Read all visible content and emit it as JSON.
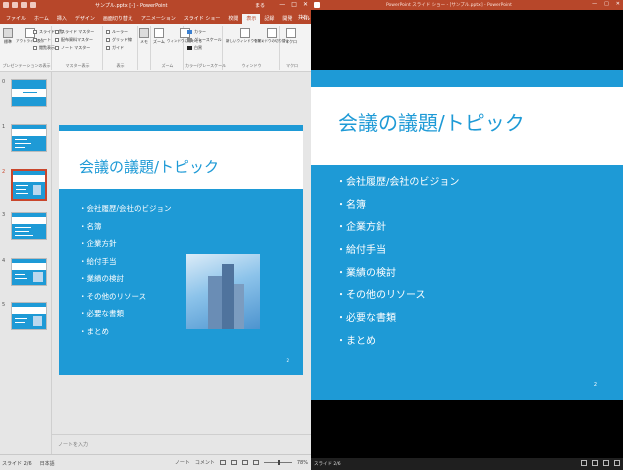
{
  "editor": {
    "title": "サンプル.pptx [-] - PowerPoint",
    "user": "まる",
    "window_controls": [
      "—",
      "□",
      "✕"
    ],
    "tabs": [
      "ファイル",
      "ホーム",
      "挿入",
      "デザイン",
      "画面切り替え",
      "アニメーション",
      "スライド ショー",
      "校閲",
      "表示",
      "記録",
      "開発",
      "ヘルプ",
      "操作アシスト"
    ],
    "active_tab": "表示",
    "share_label": "共有",
    "ribbon": {
      "groups": [
        "プレゼンテーションの表示",
        "マスター表示",
        "表示",
        "ズーム",
        "カラー/グレースケール",
        "ウィンドウ",
        "マクロ"
      ],
      "buttons": {
        "normal": "標準",
        "outline": "アウトライン表示",
        "slide_sorter": "スライド一覧",
        "notes_page": "ノート",
        "reading_view": "閲覧表示",
        "slide_master": "スライド マスター",
        "handout_master": "配布資料マスター",
        "notes_master": "ノート マスター",
        "ruler": "ルーラー",
        "gridlines": "グリッド線",
        "guides": "ガイド",
        "notes": "メモ",
        "zoom": "ズーム",
        "fit_window": "ウィンドウに合わせる",
        "color": "カラー",
        "grayscale": "グレースケール",
        "black_white": "白黒",
        "new_window": "新しいウィンドウを開く",
        "arrange": "ウィンドウの切り替え",
        "macros": "マクロ"
      }
    },
    "thumbnails": [
      {
        "num": "0",
        "label": "メインタイトル"
      },
      {
        "num": "1",
        "label": ""
      },
      {
        "num": "2",
        "label": ""
      },
      {
        "num": "3",
        "label": ""
      },
      {
        "num": "4",
        "label": ""
      },
      {
        "num": "5",
        "label": ""
      }
    ],
    "active_thumbnail": 2,
    "notes_placeholder": "ノートを入力",
    "status": {
      "slide": "スライド 2/6",
      "language": "日本語",
      "notes": "ノート",
      "comments": "コメント",
      "zoom": "78%"
    }
  },
  "slide": {
    "title": "会議の議題/トピック",
    "bullets": [
      "・会社履歴/会社のビジョン",
      "・名簿",
      "・企業方針",
      "・給付手当",
      "・業績の検討",
      "・その他のリソース",
      "・必要な書類",
      "・まとめ"
    ],
    "page_number": "2"
  },
  "show": {
    "title": "PowerPoint スライド ショー - [サンプル.pptx] - PowerPoint",
    "status": "スライド 2/6",
    "window_controls": [
      "—",
      "□",
      "✕"
    ]
  },
  "colors": {
    "accent": "#1e9ad6",
    "brand": "#b7472a"
  }
}
